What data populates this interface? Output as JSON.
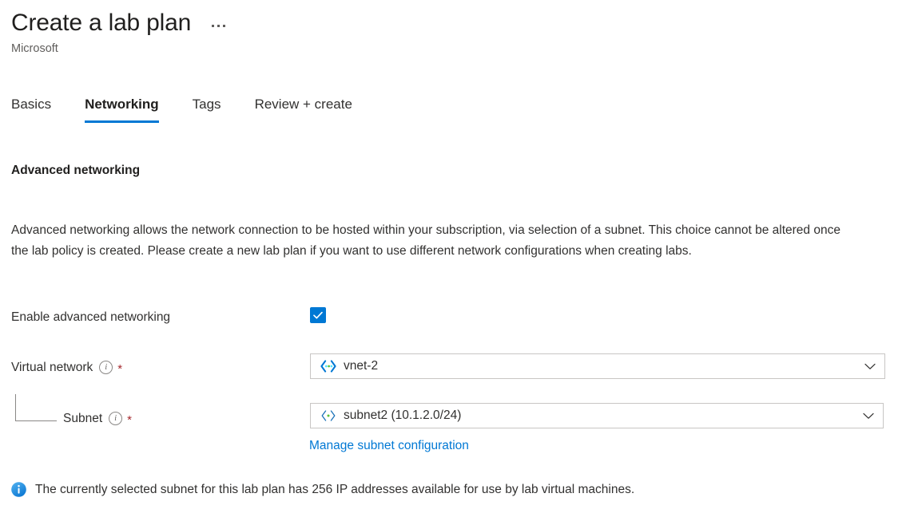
{
  "header": {
    "title": "Create a lab plan",
    "subtitle": "Microsoft",
    "more_menu_icon": "ellipsis-horizontal-icon"
  },
  "tabs": [
    {
      "label": "Basics",
      "active": false
    },
    {
      "label": "Networking",
      "active": true
    },
    {
      "label": "Tags",
      "active": false
    },
    {
      "label": "Review + create",
      "active": false
    }
  ],
  "section": {
    "heading": "Advanced networking",
    "description": "Advanced networking allows the network connection to be hosted within your subscription, via selection of a subnet. This choice cannot be altered once the lab policy is created. Please create a new lab plan if you want to use different network configurations when creating labs."
  },
  "form": {
    "enable_advanced_networking": {
      "label": "Enable advanced networking",
      "checked": true,
      "icon": "checkmark-icon"
    },
    "virtual_network": {
      "label": "Virtual network",
      "info_icon": "info-circle-icon",
      "required_marker": "*",
      "value": "vnet-2",
      "value_icon": "virtual-network-icon",
      "chevron_icon": "chevron-down-icon"
    },
    "subnet": {
      "label": "Subnet",
      "info_icon": "info-circle-icon",
      "required_marker": "*",
      "value": "subnet2 (10.1.2.0/24)",
      "value_icon": "subnet-icon",
      "chevron_icon": "chevron-down-icon"
    },
    "manage_subnet_link": "Manage subnet configuration"
  },
  "info_message": {
    "icon": "info-filled-icon",
    "text": "The currently selected subnet for this lab plan has 256 IP addresses available for use by lab virtual machines."
  },
  "colors": {
    "accent": "#0078d4",
    "link": "#0078d4",
    "required": "#a4262c",
    "text": "#323130",
    "muted": "#605e5c",
    "border": "#c8c6c4",
    "vnet_icon_blue": "#0078d4",
    "vnet_icon_green": "#5bc236",
    "vnet_icon_cyan": "#50e6ff"
  }
}
